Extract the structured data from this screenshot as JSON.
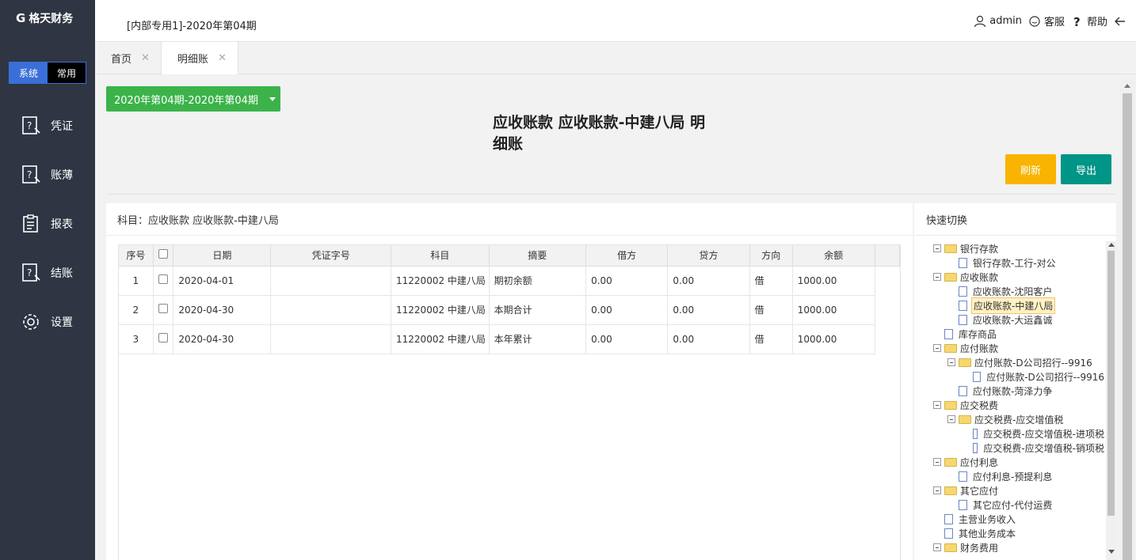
{
  "brand": {
    "logo_mark": "G",
    "name": "格天财务"
  },
  "sidebar": {
    "switch": {
      "system": "系统",
      "common": "常用"
    },
    "items": [
      {
        "label": "凭证",
        "icon": "voucher-icon"
      },
      {
        "label": "账薄",
        "icon": "ledger-icon"
      },
      {
        "label": "报表",
        "icon": "report-icon"
      },
      {
        "label": "结账",
        "icon": "closing-icon"
      },
      {
        "label": "设置",
        "icon": "gear-icon"
      }
    ]
  },
  "header": {
    "period_title": "[内部专用1]-2020年第04期",
    "user": "admin",
    "service": "客服",
    "help": "帮助"
  },
  "tabs": [
    {
      "label": "首页",
      "close": "✕"
    },
    {
      "label": "明细账",
      "close": "✕"
    }
  ],
  "main": {
    "period_selector": "2020年第04期-2020年第04期",
    "title_line1": "应收账款 应收账款-中建八局 明",
    "title_line2": "细账",
    "refresh": "刷新",
    "export": "导出",
    "subject": "科目：应收账款 应收账款-中建八局"
  },
  "table": {
    "headers": [
      "序号",
      "",
      "日期",
      "凭证字号",
      "科目",
      "摘要",
      "借方",
      "贷方",
      "方向",
      "余额"
    ],
    "rows": [
      {
        "no": "1",
        "date": "2020-04-01",
        "voucher": "",
        "subject": "11220002 中建八局",
        "summary": "期初余额",
        "debit": "0.00",
        "credit": "0.00",
        "dir": "借",
        "balance": "1000.00"
      },
      {
        "no": "2",
        "date": "2020-04-30",
        "voucher": "",
        "subject": "11220002 中建八局",
        "summary": "本期合计",
        "debit": "0.00",
        "credit": "0.00",
        "dir": "借",
        "balance": "1000.00"
      },
      {
        "no": "3",
        "date": "2020-04-30",
        "voucher": "",
        "subject": "11220002 中建八局",
        "summary": "本年累计",
        "debit": "0.00",
        "credit": "0.00",
        "dir": "借",
        "balance": "1000.00"
      }
    ]
  },
  "quick_switch": {
    "title": "快速切换",
    "tree": [
      {
        "label": "银行存款",
        "level": 0,
        "type": "folder",
        "toggle": "⊟"
      },
      {
        "label": "银行存款-工行-对公",
        "level": 1,
        "type": "doc"
      },
      {
        "label": "应收账款",
        "level": 0,
        "type": "folder",
        "toggle": "⊟"
      },
      {
        "label": "应收账款-沈阳客户",
        "level": 1,
        "type": "doc"
      },
      {
        "label": "应收账款-中建八局",
        "level": 1,
        "type": "doc",
        "selected": true
      },
      {
        "label": "应收账款-大运鑫诚",
        "level": 1,
        "type": "doc"
      },
      {
        "label": "库存商品",
        "level": 0,
        "type": "doc"
      },
      {
        "label": "应付账款",
        "level": 0,
        "type": "folder",
        "toggle": "⊟"
      },
      {
        "label": "应付账款-D公司招行--9916",
        "level": 1,
        "type": "folder",
        "toggle": "⊟"
      },
      {
        "label": "应付账款-D公司招行--9916",
        "level": 2,
        "type": "doc"
      },
      {
        "label": "应付账款-菏泽力争",
        "level": 1,
        "type": "doc"
      },
      {
        "label": "应交税费",
        "level": 0,
        "type": "folder",
        "toggle": "⊟"
      },
      {
        "label": "应交税费-应交增值税",
        "level": 1,
        "type": "folder",
        "toggle": "⊟"
      },
      {
        "label": "应交税费-应交增值税-进项税",
        "level": 2,
        "type": "doc"
      },
      {
        "label": "应交税费-应交增值税-销项税",
        "level": 2,
        "type": "doc"
      },
      {
        "label": "应付利息",
        "level": 0,
        "type": "folder",
        "toggle": "⊟"
      },
      {
        "label": "应付利息-预提利息",
        "level": 1,
        "type": "doc"
      },
      {
        "label": "其它应付",
        "level": 0,
        "type": "folder",
        "toggle": "⊟"
      },
      {
        "label": "其它应付-代付运费",
        "level": 1,
        "type": "doc"
      },
      {
        "label": "主营业务收入",
        "level": 0,
        "type": "doc"
      },
      {
        "label": "其他业务成本",
        "level": 0,
        "type": "doc"
      },
      {
        "label": "财务费用",
        "level": 0,
        "type": "folder",
        "toggle": "⊟"
      }
    ]
  },
  "colors": {
    "sidebar": "#2f3542",
    "green": "#3cb34a",
    "yellow": "#f8b400",
    "teal": "#009587",
    "blue": "#3a6fd8"
  }
}
